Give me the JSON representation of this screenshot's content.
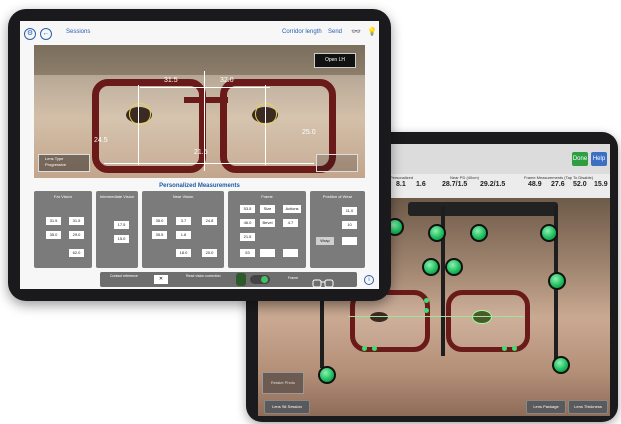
{
  "front": {
    "topbar": {
      "sessions": "Sessions",
      "corridor_length": "Corridor length",
      "send": "Send"
    },
    "open_lh_button": "Open LH",
    "lens_type": {
      "label": "Lens Type",
      "value": "Progressive"
    },
    "photo_measurements": {
      "top_left": "31.5",
      "top_right": "32.0",
      "left_height": "24.5",
      "right_height": "25.0",
      "bridge": "21.5"
    },
    "section_title": "Personalized Measurements",
    "panels": [
      {
        "title": "Far Vision",
        "rows": [
          [
            "31.5",
            "31.5"
          ],
          [
            "35.0",
            "29.0"
          ]
        ],
        "foot": [
          "62.0"
        ]
      },
      {
        "title": "Intermediate Vision",
        "rows": [
          [
            "17.5"
          ],
          [
            "15.0"
          ]
        ]
      },
      {
        "title": "Near Vision",
        "rows": [
          [
            "35.0",
            "3.7",
            "24.8"
          ],
          [
            "35.5",
            "1.8"
          ],
          [
            "18.0",
            "20.0"
          ]
        ]
      },
      {
        "title": "Frame",
        "rows": [
          [
            "53.5",
            "Size",
            "Actions"
          ],
          [
            "46.0",
            "Bevel",
            "4.7"
          ],
          [
            "21.5"
          ]
        ],
        "foot": [
          "53"
        ]
      },
      {
        "title": "Position of Wear",
        "rows": [
          [
            "11.0"
          ],
          [
            "10"
          ]
        ],
        "button": "Wrap"
      }
    ],
    "bottom": {
      "contact_ref": "Contact reference",
      "read_lens": "Read vision correction",
      "frame": "Frame"
    }
  },
  "back": {
    "buttons": {
      "done": "Done",
      "help": "Help"
    },
    "headers": {
      "personalized": "Personalized",
      "near_pd": "Near PD (40cm)",
      "frame_meas": "Frame Measurements (Tap To Disable)"
    },
    "values": [
      "8.1",
      "1.6",
      "28.7/1.5",
      "29.2/1.5",
      "48.9",
      "27.6",
      "52.0",
      "15.9"
    ],
    "bottom": {
      "left": "Lens Sit Session",
      "mid": "Lens Package",
      "right": "Lens Thickness"
    },
    "photo_label": "Retake Photo"
  }
}
